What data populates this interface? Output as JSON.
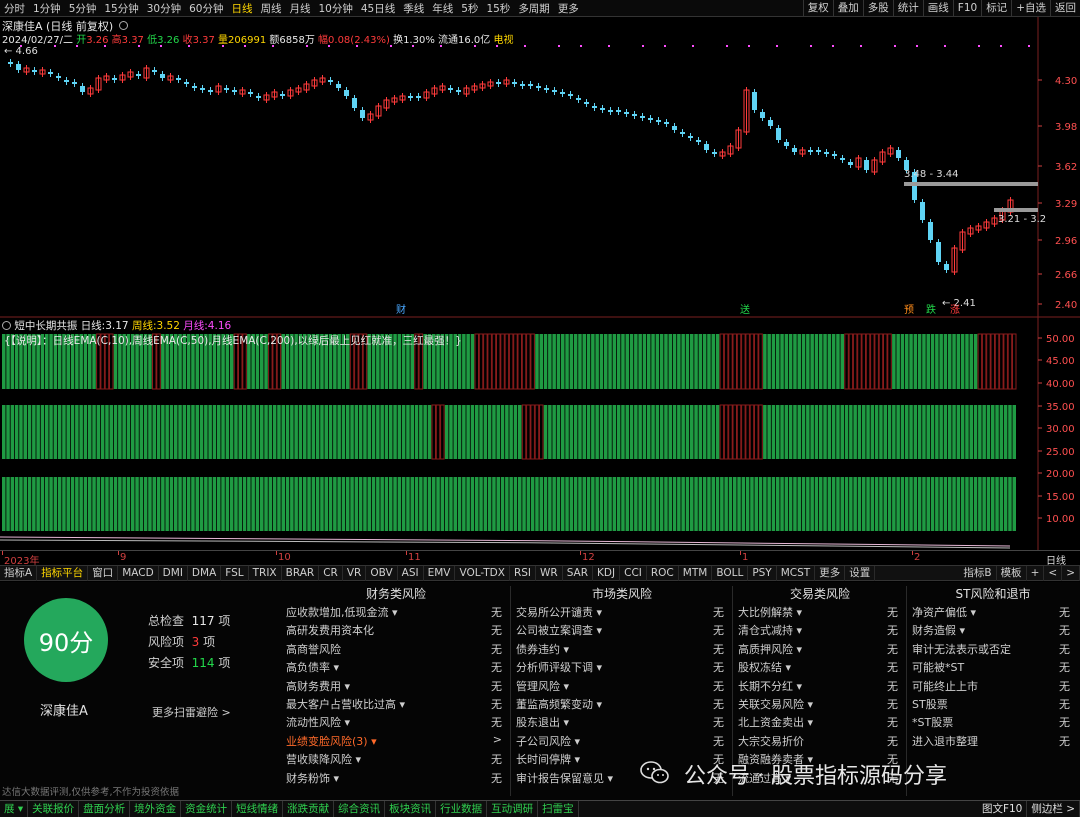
{
  "toolbar": {
    "left": [
      "分时",
      "1分钟",
      "5分钟",
      "15分钟",
      "30分钟",
      "60分钟",
      "日线",
      "周线",
      "月线",
      "10分钟",
      "45日线",
      "季线",
      "年线",
      "5秒",
      "15秒",
      "多周期",
      "更多"
    ],
    "active": "日线",
    "right": [
      "复权",
      "叠加",
      "多股",
      "统计",
      "画线",
      "F10",
      "标记",
      "+自选",
      "返回"
    ]
  },
  "header": {
    "stock": "深康佳A",
    "mode": "(日线 前复权)",
    "date": "2024/02/27/二",
    "open_label": "开",
    "open": "3.26",
    "high_label": "高",
    "high": "3.37",
    "low_label": "低",
    "low": "3.26",
    "close_label": "收",
    "close": "3.37",
    "vol_label": "量",
    "vol": "206991",
    "amt_label": "额",
    "amt": "6858万",
    "chg_label": "幅",
    "chg": "0.08(2.43%)",
    "turn_label": "换",
    "turn": "1.30%",
    "float_label": "流通",
    "float": "16.0亿",
    "tag": "电视"
  },
  "price_axis": [
    "4.30",
    "3.98",
    "3.62",
    "3.29",
    "2.96",
    "2.66",
    "2.40"
  ],
  "annotations": {
    "hi": "4.66",
    "lo": "2.41",
    "range1": "3.48 - 3.44",
    "range2": "3.21 - 3.2"
  },
  "event_marks": [
    {
      "text": "财",
      "color": "#4aa8ff"
    },
    {
      "text": "送",
      "color": "#22d84a"
    },
    {
      "text": "预",
      "color": "#ff8c1a"
    },
    {
      "text": "跌",
      "color": "#22d84a"
    },
    {
      "text": "涨",
      "color": "#ff3b3b"
    }
  ],
  "indicator": {
    "name": "短中长期共振",
    "d_label": "日线:",
    "d_val": "3.17",
    "w_label": "周线:",
    "w_val": "3.52",
    "m_label": "月线:",
    "m_val": "4.16",
    "note": "{【说明】：日线EMA(C,10),周线EMA(C,50),月线EMA(C,200),以绿后最上见红就准，三红最强！}",
    "axis": [
      "50.00",
      "45.00",
      "40.00",
      "35.00",
      "30.00",
      "25.00",
      "20.00",
      "15.00",
      "10.00"
    ]
  },
  "time_axis": [
    "2023年",
    "9",
    "10",
    "11",
    "12",
    "1",
    "2"
  ],
  "time_right": "日线",
  "tabs": [
    "指标A",
    "指标平台",
    "窗口",
    "MACD",
    "DMI",
    "DMA",
    "FSL",
    "TRIX",
    "BRAR",
    "CR",
    "VR",
    "OBV",
    "ASI",
    "EMV",
    "VOL-TDX",
    "RSI",
    "WR",
    "SAR",
    "KDJ",
    "CCI",
    "ROC",
    "MTM",
    "BOLL",
    "PSY",
    "MCST",
    "更多",
    "设置"
  ],
  "tabs_active": "指标平台",
  "tabs_right": [
    "指标B",
    "模板",
    "+",
    "<",
    ">"
  ],
  "risk": {
    "score": "90分",
    "stock": "深康佳A",
    "total_label": "总检查",
    "total": "117",
    "unit": "项",
    "risk_label": "风险项",
    "risk": "3",
    "safe_label": "安全项",
    "safe": "114",
    "more": "更多扫雷避险 >",
    "disclaimer": "达信大数据评测,仅供参考,不作为投资依据",
    "columns": [
      {
        "title": "财务类风险",
        "items": [
          {
            "label": "应收款增加,低现金流 ▾",
            "val": "无"
          },
          {
            "label": "高研发费用资本化",
            "val": "无"
          },
          {
            "label": "高商誉风险",
            "val": "无"
          },
          {
            "label": "高负债率 ▾",
            "val": "无"
          },
          {
            "label": "高财务费用 ▾",
            "val": "无"
          },
          {
            "label": "最大客户占营收比过高 ▾",
            "val": "无"
          },
          {
            "label": "流动性风险 ▾",
            "val": "无"
          },
          {
            "label": "业绩变脸风险(3) ▾",
            "val": ">"
          },
          {
            "label": "营收赎降风险 ▾",
            "val": "无"
          },
          {
            "label": "财务粉饰 ▾",
            "val": "无"
          }
        ]
      },
      {
        "title": "市场类风险",
        "items": [
          {
            "label": "交易所公开谴责 ▾",
            "val": "无"
          },
          {
            "label": "公司被立案调查 ▾",
            "val": "无"
          },
          {
            "label": "债券违约 ▾",
            "val": "无"
          },
          {
            "label": "分析师评级下调 ▾",
            "val": "无"
          },
          {
            "label": "管理风险 ▾",
            "val": "无"
          },
          {
            "label": "董监高频繁变动 ▾",
            "val": "无"
          },
          {
            "label": "股东退出 ▾",
            "val": "无"
          },
          {
            "label": "子公司风险 ▾",
            "val": "无"
          },
          {
            "label": "长时间停牌 ▾",
            "val": "无"
          },
          {
            "label": "审计报告保留意见 ▾",
            "val": "无"
          }
        ]
      },
      {
        "title": "交易类风险",
        "items": [
          {
            "label": "大比例解禁 ▾",
            "val": "无"
          },
          {
            "label": "清仓式减持 ▾",
            "val": "无"
          },
          {
            "label": "高质押风险 ▾",
            "val": "无"
          },
          {
            "label": "股权冻结 ▾",
            "val": "无"
          },
          {
            "label": "长期不分红 ▾",
            "val": "无"
          },
          {
            "label": "关联交易风险 ▾",
            "val": "无"
          },
          {
            "label": "北上资金卖出 ▾",
            "val": "无"
          },
          {
            "label": "大宗交易折价",
            "val": "无"
          },
          {
            "label": "融资融券卖者 ▾",
            "val": "无"
          },
          {
            "label": "流通过高 ▾",
            "val": "无"
          }
        ]
      },
      {
        "title": "ST风险和退市",
        "items": [
          {
            "label": "净资产偏低 ▾",
            "val": "无"
          },
          {
            "label": "财务造假 ▾",
            "val": "无"
          },
          {
            "label": "审计无法表示或否定",
            "val": "无"
          },
          {
            "label": "可能被*ST",
            "val": "无"
          },
          {
            "label": "可能终止上市",
            "val": "无"
          },
          {
            "label": "ST股票",
            "val": "无"
          },
          {
            "label": "*ST股票",
            "val": "无"
          },
          {
            "label": "进入退市整理",
            "val": "无"
          }
        ]
      }
    ]
  },
  "bottombar": [
    "展 ▾",
    "关联报价",
    "盘面分析",
    "境外资金",
    "资金统计",
    "短线情绪",
    "涨跌贡献",
    "综合资讯",
    "板块资讯",
    "行业数据",
    "互动调研",
    "扫雷宝"
  ],
  "bottom_right": [
    "图文F10",
    "侧边栏 >"
  ],
  "watermark": "公众号 · 股票指标源码分享",
  "colors": {
    "up": "#ff3b3b",
    "down": "#5fd4f5",
    "green_bar": "#1f9b43",
    "red_bar": "#8a1c1c",
    "accent": "#ffd700"
  }
}
